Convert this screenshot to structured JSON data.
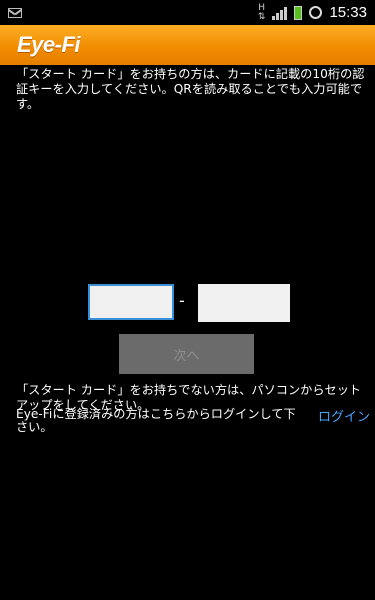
{
  "status_bar": {
    "time": "15:33",
    "network_label": "H",
    "icons": [
      "mail-icon",
      "data-h-icon",
      "signal-icon",
      "battery-icon",
      "alarm-icon"
    ],
    "battery_color": "#55c21b"
  },
  "header": {
    "logo": "Eye-Fi",
    "background": "#f08a00"
  },
  "main": {
    "intro_text": "「スタート カード」をお持ちの方は、カードに記載の10桁の認証キーを入力してください。QRを読み取ることでも入力可能です。",
    "code_separator": "-",
    "code_field_1_value": "",
    "code_field_2_value": "",
    "next_button_label": "次へ",
    "no_card_text": "「スタート カード」をお持ちでない方は、パソコンからセットアップをしてください。",
    "registered_text": "Eye-Fiに登録済みの方はこちらからログインして下さい。",
    "login_link": "ログイン",
    "link_color": "#4aa4ff",
    "focus_color": "#3b8fd6"
  }
}
